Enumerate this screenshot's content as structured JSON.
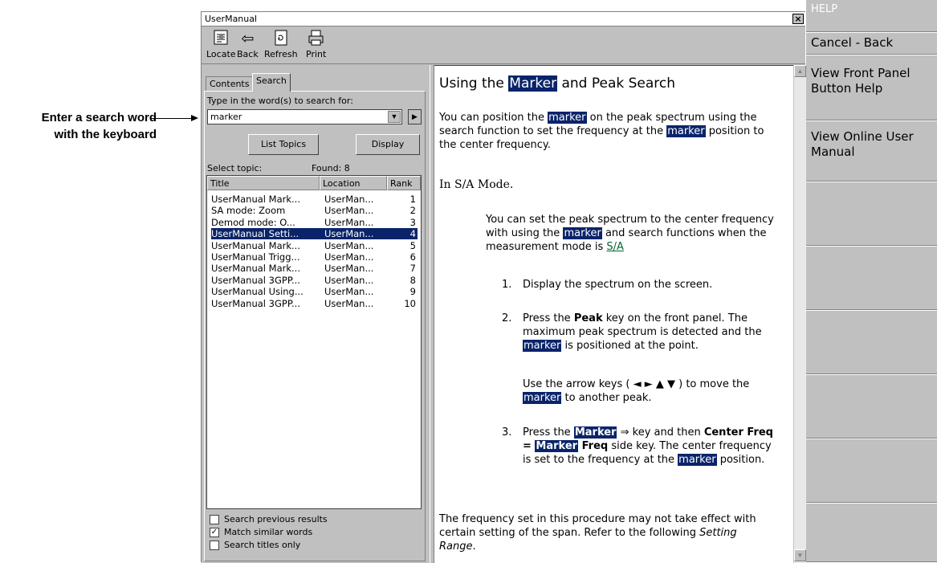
{
  "callout": {
    "line1": "Enter a search word",
    "line2": "with the keyboard"
  },
  "window": {
    "title": "UserManual",
    "close": "×"
  },
  "toolbar": {
    "locate": {
      "label": "Locate",
      "icon": "locate-icon"
    },
    "back": {
      "label": "Back",
      "icon": "back-arrow-icon"
    },
    "refresh": {
      "label": "Refresh",
      "icon": "refresh-icon"
    },
    "print": {
      "label": "Print",
      "icon": "printer-icon"
    }
  },
  "tabs": {
    "contents": "Contents",
    "search": "Search"
  },
  "search": {
    "prompt": "Type in the word(s) to search for:",
    "value": "marker",
    "list_topics": "List Topics",
    "display": "Display",
    "select_topic": "Select topic:",
    "found": "Found: 8"
  },
  "results": {
    "columns": [
      "Title",
      "Location",
      "Rank"
    ],
    "rows": [
      {
        "title": "UserManual Mark...",
        "location": "UserMan...",
        "rank": "1"
      },
      {
        "title": "SA mode: Zoom",
        "location": "UserMan...",
        "rank": "2"
      },
      {
        "title": "Demod mode: O...",
        "location": "UserMan...",
        "rank": "3"
      },
      {
        "title": "UserManual Setti...",
        "location": "UserMan...",
        "rank": "4"
      },
      {
        "title": "UserManual Mark...",
        "location": "UserMan...",
        "rank": "5"
      },
      {
        "title": "UserManual Trigg...",
        "location": "UserMan...",
        "rank": "6"
      },
      {
        "title": "UserManual Mark...",
        "location": "UserMan...",
        "rank": "7"
      },
      {
        "title": "UserManual 3GPP...",
        "location": "UserMan...",
        "rank": "8"
      },
      {
        "title": "UserManual Using...",
        "location": "UserMan...",
        "rank": "9"
      },
      {
        "title": "UserManual 3GPP...",
        "location": "UserMan...",
        "rank": "10"
      }
    ],
    "selected_rank": "4"
  },
  "options": {
    "prev": {
      "label": "Search previous results",
      "checked": false
    },
    "similar": {
      "label": "Match similar words",
      "checked": true
    },
    "titles": {
      "label": "Search titles only",
      "checked": false
    }
  },
  "content": {
    "heading_pre": "Using the ",
    "heading_hl": "Marker",
    "heading_post": " and Peak Search",
    "p1": [
      "You can position the ",
      "marker",
      " on the peak spectrum using the search function to set the frequency at the ",
      "marker",
      " position to the center frequency."
    ],
    "mode_heading": "In S/A Mode.",
    "p2": [
      "You can set the peak spectrum to the center frequency with using the ",
      "marker",
      " and search functions when the measurement mode is ",
      "S/A"
    ],
    "step1": "Display the spectrum on the screen.",
    "step2": [
      "Press the ",
      "Peak",
      " key on the front panel. The maximum peak spectrum is detected and the ",
      "marker",
      " is positioned at the point."
    ],
    "step2b": [
      "Use the arrow keys ( ◄ ► ▲ ▼ ) to move the ",
      "marker",
      " to another peak."
    ],
    "step3": [
      "Press the ",
      "Marker",
      " ⇒ key and then ",
      "Center Freq = ",
      "Marker",
      " Freq",
      " side key. The center frequency is set to the frequency at the ",
      "marker",
      " position."
    ],
    "footer": [
      "The frequency set in this procedure may not take effect with certain setting of the span. Refer to the following ",
      "Setting Range",
      "."
    ]
  },
  "side_menu": {
    "help": "HELP",
    "cancel": "Cancel - Back",
    "front_panel": "View Front Panel Button Help",
    "online_manual": "View Online User Manual"
  }
}
